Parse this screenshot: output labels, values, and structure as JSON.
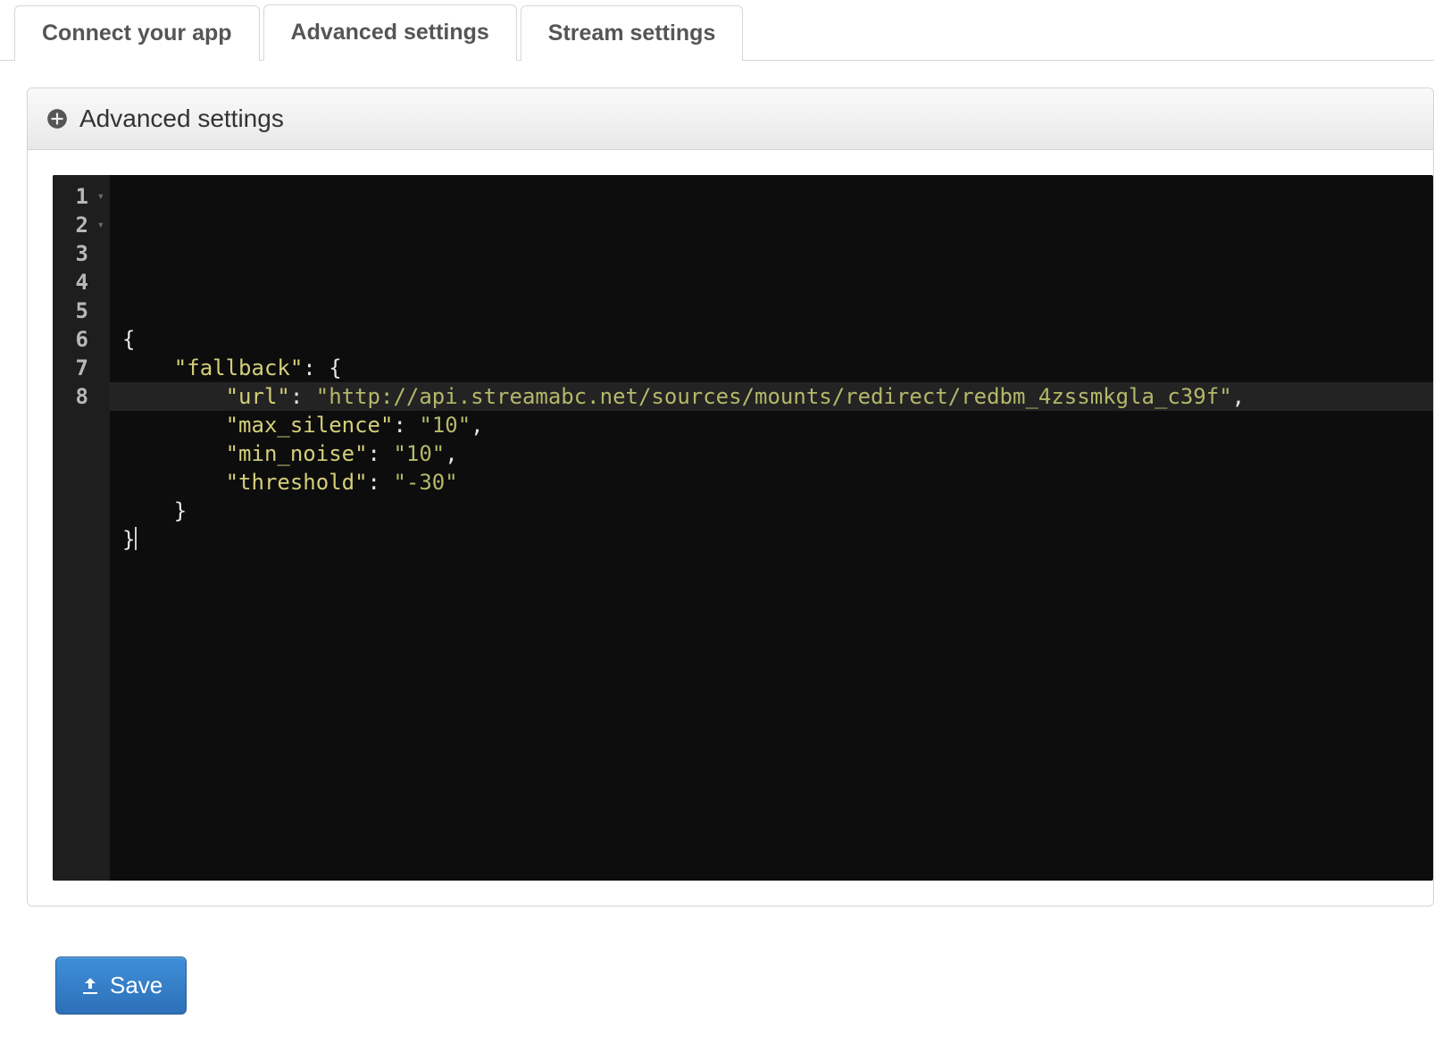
{
  "tabs": [
    {
      "label": "Connect your app",
      "active": false
    },
    {
      "label": "Advanced settings",
      "active": true
    },
    {
      "label": "Stream settings",
      "active": false
    }
  ],
  "panel": {
    "title": "Advanced settings"
  },
  "editor": {
    "gutter": [
      "1",
      "2",
      "3",
      "4",
      "5",
      "6",
      "7",
      "8"
    ],
    "foldable_lines": [
      1,
      2
    ],
    "active_line": 8,
    "content": {
      "fallback": {
        "url": "http://api.streamabc.net/sources/mounts/redirect/redbm_4zssmkgla_c39f",
        "max_silence": "10",
        "min_noise": "10",
        "threshold": "-30"
      }
    },
    "lines": [
      {
        "tokens": [
          {
            "t": "{",
            "c": "punc"
          }
        ]
      },
      {
        "indent": 4,
        "tokens": [
          {
            "t": "\"fallback\"",
            "c": "key"
          },
          {
            "t": ": ",
            "c": "punc"
          },
          {
            "t": "{",
            "c": "punc"
          }
        ]
      },
      {
        "indent": 8,
        "tokens": [
          {
            "t": "\"url\"",
            "c": "key"
          },
          {
            "t": ": ",
            "c": "punc"
          },
          {
            "t": "\"http://api.streamabc.net/sources/mounts/redirect/redbm_4zssmkgla_c39f\"",
            "c": "val"
          },
          {
            "t": ",",
            "c": "punc"
          }
        ]
      },
      {
        "indent": 8,
        "tokens": [
          {
            "t": "\"max_silence\"",
            "c": "key"
          },
          {
            "t": ": ",
            "c": "punc"
          },
          {
            "t": "\"10\"",
            "c": "val"
          },
          {
            "t": ",",
            "c": "punc"
          }
        ]
      },
      {
        "indent": 8,
        "tokens": [
          {
            "t": "\"min_noise\"",
            "c": "key"
          },
          {
            "t": ": ",
            "c": "punc"
          },
          {
            "t": "\"10\"",
            "c": "val"
          },
          {
            "t": ",",
            "c": "punc"
          }
        ]
      },
      {
        "indent": 8,
        "tokens": [
          {
            "t": "\"threshold\"",
            "c": "key"
          },
          {
            "t": ": ",
            "c": "punc"
          },
          {
            "t": "\"-30\"",
            "c": "val"
          }
        ]
      },
      {
        "indent": 4,
        "tokens": [
          {
            "t": "}",
            "c": "punc"
          }
        ]
      },
      {
        "indent": 0,
        "tokens": [
          {
            "t": "}",
            "c": "punc"
          }
        ],
        "cursor_after": true
      }
    ]
  },
  "actions": {
    "save_label": "Save"
  }
}
